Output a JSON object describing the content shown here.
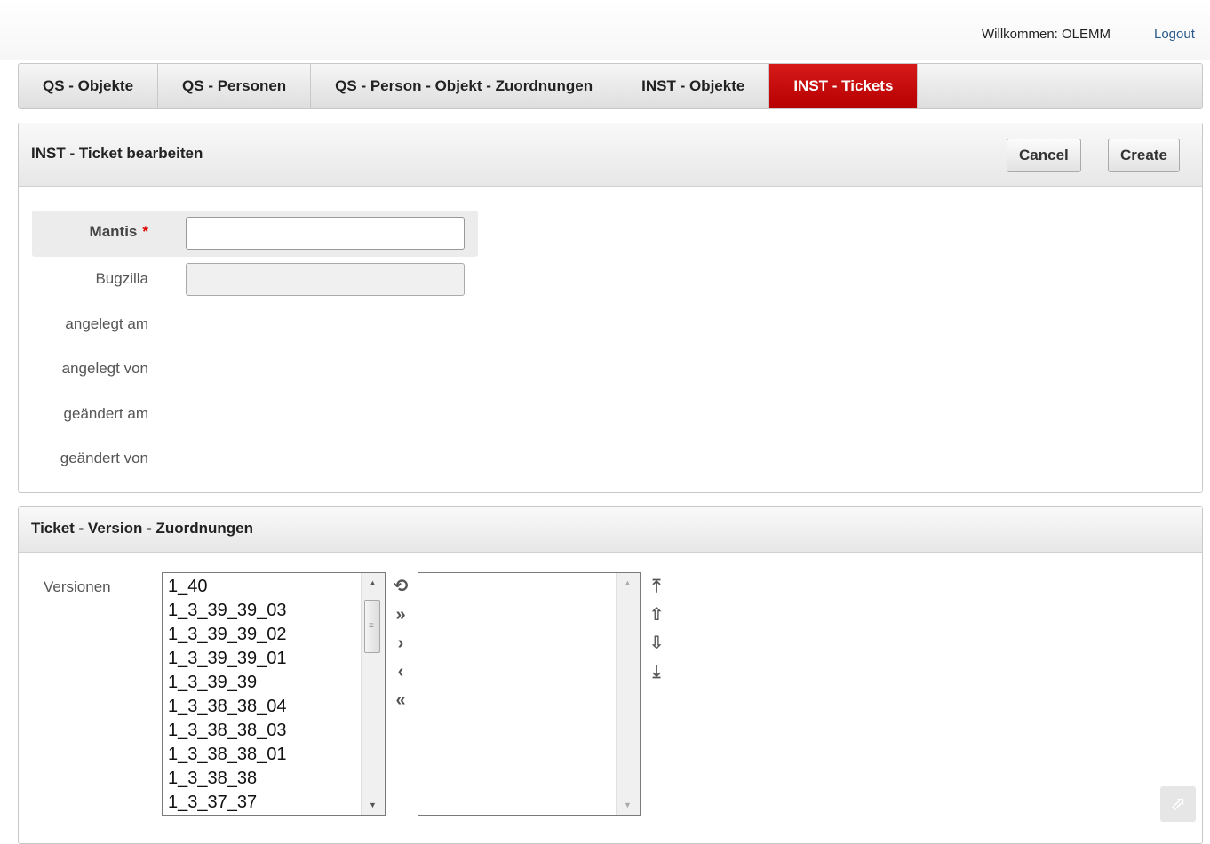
{
  "header": {
    "welcome": "Willkommen: OLEMM",
    "logout": "Logout"
  },
  "tabs": [
    {
      "label": "QS - Objekte"
    },
    {
      "label": "QS - Personen"
    },
    {
      "label": "QS - Person - Objekt - Zuordnungen"
    },
    {
      "label": "INST - Objekte"
    },
    {
      "label": "INST - Tickets"
    }
  ],
  "active_tab": "INST - Tickets",
  "edit_panel": {
    "title": "INST - Ticket bearbeiten",
    "cancel": "Cancel",
    "create": "Create",
    "fields": {
      "mantis": {
        "label": "Mantis",
        "required_mark": "*",
        "value": ""
      },
      "bugzilla": {
        "label": "Bugzilla",
        "value": ""
      },
      "angelegt_am": {
        "label": "angelegt am"
      },
      "angelegt_von": {
        "label": "angelegt von"
      },
      "geaendert_am": {
        "label": "geändert am"
      },
      "geaendert_von": {
        "label": "geändert von"
      }
    }
  },
  "version_panel": {
    "title": "Ticket - Version - Zuordnungen",
    "label": "Versionen",
    "available": [
      "1_40",
      "1_3_39_39_03",
      "1_3_39_39_02",
      "1_3_39_39_01",
      "1_3_39_39",
      "1_3_38_38_04",
      "1_3_38_38_03",
      "1_3_38_38_01",
      "1_3_38_38",
      "1_3_37_37"
    ],
    "selected": []
  },
  "colors": {
    "active_tab": "#c00000",
    "required": "#dd0000"
  },
  "icons": {
    "shuttle": [
      "reset-icon",
      "move-all-right-icon",
      "move-right-icon",
      "move-left-icon",
      "move-all-left-icon"
    ],
    "order": [
      "move-top-icon",
      "move-up-icon",
      "move-down-icon",
      "move-bottom-icon"
    ],
    "corner": "share-icon"
  }
}
